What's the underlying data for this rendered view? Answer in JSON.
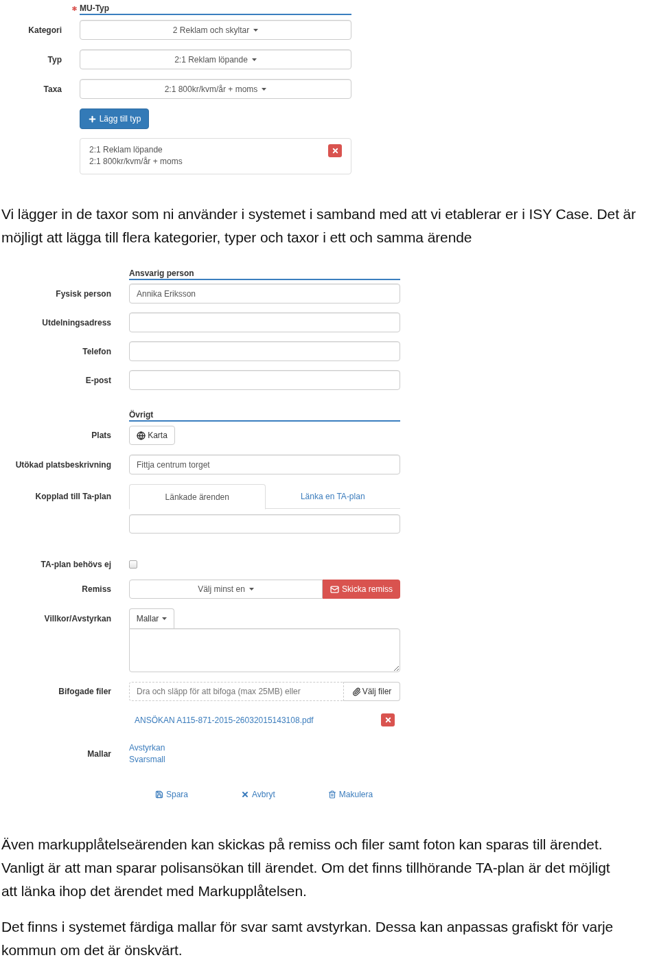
{
  "mu_typ": {
    "title": "MU-Typ",
    "required": true,
    "selects": [
      {
        "label": "Kategori",
        "value": "2 Reklam och skyltar"
      },
      {
        "label": "Typ",
        "value": "2:1 Reklam löpande"
      },
      {
        "label": "Taxa",
        "value": "2:1 800kr/kvm/år + moms"
      }
    ],
    "add_button": "Lägg till typ",
    "added": [
      {
        "lines": [
          "2:1 Reklam löpande",
          "2:1 800kr/kvm/år + moms"
        ]
      }
    ]
  },
  "intro_paragraph": "Vi lägger in de taxor som ni använder i systemet i samband med att vi etablerar er i ISY Case. Det är möjligt att lägga till flera kategorier, typer och taxor i ett och samma ärende",
  "ansvarig_person": {
    "title": "Ansvarig person",
    "fields": [
      {
        "label": "Fysisk person",
        "value": "Annika Eriksson"
      },
      {
        "label": "Utdelningsadress"
      },
      {
        "label": "Telefon"
      },
      {
        "label": "E-post"
      }
    ]
  },
  "ovrigt": {
    "title": "Övrigt",
    "rows": [
      {
        "kind": "button",
        "label": "Plats",
        "button": "Karta"
      },
      {
        "kind": "input",
        "label": "Utökad platsbeskrivning",
        "value": "Fittja centrum torget"
      },
      {
        "kind": "tabs",
        "label": "Kopplad till Ta-plan",
        "tabs": [
          {
            "label": "Länkade ärenden",
            "selected": true
          },
          {
            "label": "Länka en TA-plan",
            "selected": false
          }
        ]
      },
      {
        "kind": "checkbox",
        "label": "TA-plan behövs ej",
        "checked": false
      },
      {
        "kind": "select_action",
        "label": "Remiss",
        "value": "Välj minst en",
        "button": "Skicka remiss"
      },
      {
        "kind": "textarea",
        "label": "Villkor/Avstyrkan",
        "menu": "Mallar"
      },
      {
        "kind": "files",
        "label": "Bifogade filer",
        "drop_text": "Dra och släpp för att bifoga (max 25MB) eller",
        "button": "Välj filer",
        "files": [
          "ANSÖKAN A115-871-2015-26032015143108.pdf"
        ]
      },
      {
        "kind": "links",
        "label": "Mallar",
        "links": [
          "Avstyrkan",
          "Svarsmall"
        ]
      }
    ]
  },
  "actions": [
    {
      "kind": "save",
      "label": "Spara"
    },
    {
      "kind": "cancel",
      "label": "Avbryt"
    },
    {
      "kind": "delete",
      "label": "Makulera"
    }
  ],
  "paragraphs": [
    "Även markupplåtelseärenden kan skickas på remiss och filer samt foton kan sparas till ärendet. Vanligt är att man sparar polisansökan till ärendet. Om det finns tillhörande TA-plan är det möjligt att länka ihop det ärendet med Markupplåtelsen.",
    "Det finns i systemet färdiga mallar för svar samt avstyrkan. Dessa kan anpassas grafiskt för varje kommun om det är önskvärt."
  ]
}
